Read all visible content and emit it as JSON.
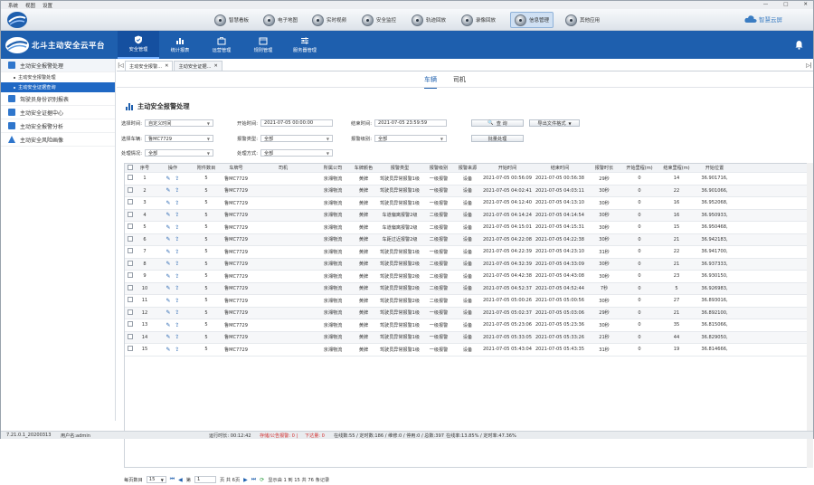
{
  "menubar": {
    "items": [
      "系统",
      "视图",
      "设置"
    ]
  },
  "window_controls": [
    "—",
    "□",
    "✕"
  ],
  "toolbar": {
    "buttons": [
      {
        "label": "智慧看板",
        "icon": "dashboard-icon"
      },
      {
        "label": "电子地图",
        "icon": "map-icon"
      },
      {
        "label": "实时视频",
        "icon": "video-icon"
      },
      {
        "label": "安全监控",
        "icon": "monitor-icon"
      },
      {
        "label": "轨迹回放",
        "icon": "track-icon"
      },
      {
        "label": "录像回放",
        "icon": "playback-icon"
      },
      {
        "label": "信息管理",
        "icon": "info-icon",
        "active": true
      },
      {
        "label": "其他应用",
        "icon": "apps-icon"
      }
    ],
    "brand": "智慧云屏"
  },
  "nav": {
    "title": "北斗主动安全云平台",
    "tabs": [
      {
        "label": "安全管理",
        "icon": "shield-icon",
        "active": true
      },
      {
        "label": "统计报表",
        "icon": "bar-chart-icon"
      },
      {
        "label": "运营管理",
        "icon": "briefcase-icon"
      },
      {
        "label": "规则管理",
        "icon": "calendar-icon"
      },
      {
        "label": "服务器管理",
        "icon": "sliders-icon"
      }
    ]
  },
  "sidebar": {
    "groups": [
      {
        "label": "主动安全报警处理",
        "open": true,
        "children": [
          {
            "label": "主动安全报警处理",
            "selected": false
          },
          {
            "label": "主动安全证据查询",
            "selected": true
          }
        ]
      },
      {
        "label": "驾驶员身份识别报表"
      },
      {
        "label": "主动安全证据中心"
      },
      {
        "label": "主动安全报警分析"
      },
      {
        "label": "主动安全风险画像"
      }
    ]
  },
  "page_tabs": {
    "left_arrow": "|◁",
    "right_arrow": "▷|",
    "tabs": [
      {
        "label": "主动安全报警...",
        "active": true
      },
      {
        "label": "主动安全证据..."
      }
    ]
  },
  "subtabs": [
    "车辆",
    "司机"
  ],
  "section_title": "主动安全报警处理",
  "filters": {
    "time_label": "选择时间:",
    "time_value": "自定义时间",
    "start_label": "开始时间:",
    "start_value": "2021-07-05 00:00:00",
    "end_label": "结束时间:",
    "end_value": "2021-07-05 23:59:59",
    "vehicle_label": "选择车辆:",
    "vehicle_value": "鲁MC7729",
    "alarmtype_label": "报警类型:",
    "alarmtype_value": "全部",
    "alarmlevel_label": "报警级别:",
    "alarmlevel_value": "全部",
    "status_label": "处理情况:",
    "status_value": "全部",
    "method_label": "处理方式:",
    "method_value": "全部",
    "query_btn": "查 询",
    "export_btn": "导出文件格式",
    "batch_btn": "批量处理"
  },
  "table": {
    "headers": [
      "序号",
      "操作",
      "附件数目",
      "车牌号",
      "司机",
      "所属公司",
      "车牌颜色",
      "报警类型",
      "报警级别",
      "报警来源",
      "开始时间",
      "结束时间",
      "报警时长",
      "开始里程(m)",
      "结束里程(m)",
      "开始位置"
    ],
    "rows": [
      [
        "1",
        "5",
        "鲁MC7729",
        "",
        "京湘物流",
        "黄牌",
        "驾驶员异常报警1级",
        "一级报警",
        "设备",
        "2021-07-05 00:56:09",
        "2021-07-05 00:56:38",
        "29秒",
        "0",
        "14",
        "36.901716,"
      ],
      [
        "2",
        "5",
        "鲁MC7729",
        "",
        "京湘物流",
        "黄牌",
        "驾驶员异常报警1级",
        "一级报警",
        "设备",
        "2021-07-05 04:02:41",
        "2021-07-05 04:03:11",
        "30秒",
        "0",
        "22",
        "36.901066,"
      ],
      [
        "3",
        "5",
        "鲁MC7729",
        "",
        "京湘物流",
        "黄牌",
        "驾驶员异常报警1级",
        "一级报警",
        "设备",
        "2021-07-05 04:12:40",
        "2021-07-05 04:13:10",
        "30秒",
        "0",
        "16",
        "36.952068,"
      ],
      [
        "4",
        "5",
        "鲁MC7729",
        "",
        "京湘物流",
        "黄牌",
        "车道偏离报警2级",
        "二级报警",
        "设备",
        "2021-07-05 04:14:24",
        "2021-07-05 04:14:54",
        "30秒",
        "0",
        "16",
        "36.950933,"
      ],
      [
        "5",
        "5",
        "鲁MC7729",
        "",
        "京湘物流",
        "黄牌",
        "车道偏离报警2级",
        "二级报警",
        "设备",
        "2021-07-05 04:15:01",
        "2021-07-05 04:15:31",
        "30秒",
        "0",
        "15",
        "36.950468,"
      ],
      [
        "6",
        "5",
        "鲁MC7729",
        "",
        "京湘物流",
        "黄牌",
        "车距过近报警2级",
        "二级报警",
        "设备",
        "2021-07-05 04:22:08",
        "2021-07-05 04:22:38",
        "30秒",
        "0",
        "21",
        "36.942183,"
      ],
      [
        "7",
        "5",
        "鲁MC7729",
        "",
        "京湘物流",
        "黄牌",
        "驾驶员异常报警1级",
        "一级报警",
        "设备",
        "2021-07-05 04:22:39",
        "2021-07-05 04:23:10",
        "31秒",
        "0",
        "22",
        "36.941700,"
      ],
      [
        "8",
        "5",
        "鲁MC7729",
        "",
        "京湘物流",
        "黄牌",
        "驾驶员异常报警2级",
        "二级报警",
        "设备",
        "2021-07-05 04:32:39",
        "2021-07-05 04:33:09",
        "30秒",
        "0",
        "21",
        "36.937333,"
      ],
      [
        "9",
        "5",
        "鲁MC7729",
        "",
        "京湘物流",
        "黄牌",
        "驾驶员异常报警2级",
        "二级报警",
        "设备",
        "2021-07-05 04:42:38",
        "2021-07-05 04:43:08",
        "30秒",
        "0",
        "23",
        "36.930150,"
      ],
      [
        "10",
        "5",
        "鲁MC7729",
        "",
        "京湘物流",
        "黄牌",
        "驾驶员异常报警2级",
        "二级报警",
        "设备",
        "2021-07-05 04:52:37",
        "2021-07-05 04:52:44",
        "7秒",
        "0",
        "5",
        "36.926983,"
      ],
      [
        "11",
        "5",
        "鲁MC7729",
        "",
        "京湘物流",
        "黄牌",
        "驾驶员异常报警2级",
        "二级报警",
        "设备",
        "2021-07-05 05:00:26",
        "2021-07-05 05:00:56",
        "30秒",
        "0",
        "27",
        "36.893016,"
      ],
      [
        "12",
        "5",
        "鲁MC7729",
        "",
        "京湘物流",
        "黄牌",
        "驾驶员异常报警1级",
        "一级报警",
        "设备",
        "2021-07-05 05:02:37",
        "2021-07-05 05:03:06",
        "29秒",
        "0",
        "21",
        "36.892100,"
      ],
      [
        "13",
        "5",
        "鲁MC7729",
        "",
        "京湘物流",
        "黄牌",
        "驾驶员异常报警1级",
        "一级报警",
        "设备",
        "2021-07-05 05:23:06",
        "2021-07-05 05:23:36",
        "30秒",
        "0",
        "35",
        "36.815066,"
      ],
      [
        "14",
        "5",
        "鲁MC7729",
        "",
        "京湘物流",
        "黄牌",
        "驾驶员异常报警1级",
        "一级报警",
        "设备",
        "2021-07-05 05:33:05",
        "2021-07-05 05:33:26",
        "21秒",
        "0",
        "44",
        "36.829050,"
      ],
      [
        "15",
        "5",
        "鲁MC7729",
        "",
        "京湘物流",
        "黄牌",
        "驾驶员异常报警1级",
        "一级报警",
        "设备",
        "2021-07-05 05:43:04",
        "2021-07-05 05:43:35",
        "31秒",
        "0",
        "19",
        "36.814666,"
      ]
    ]
  },
  "pager": {
    "page_size_label": "每页数目",
    "page_size": "15",
    "page_label": "第",
    "page_value": "1",
    "of_label": "页 共 6页",
    "summary": "显示由 1 到 15 共 76 条记录"
  },
  "status": {
    "version": "7.21.0.1_20200313",
    "user": "用户名:admin",
    "uptime": "运行时长: 00:12:42",
    "unhandled": "存储/公告报警: 0 |",
    "pending": "下达量: 0",
    "online": "在线数:55 / 定时数:186 / 维修:0 / 停用:0 / 总数:397",
    "rates": "在线率:13.85% / 定时率:47.36%"
  }
}
